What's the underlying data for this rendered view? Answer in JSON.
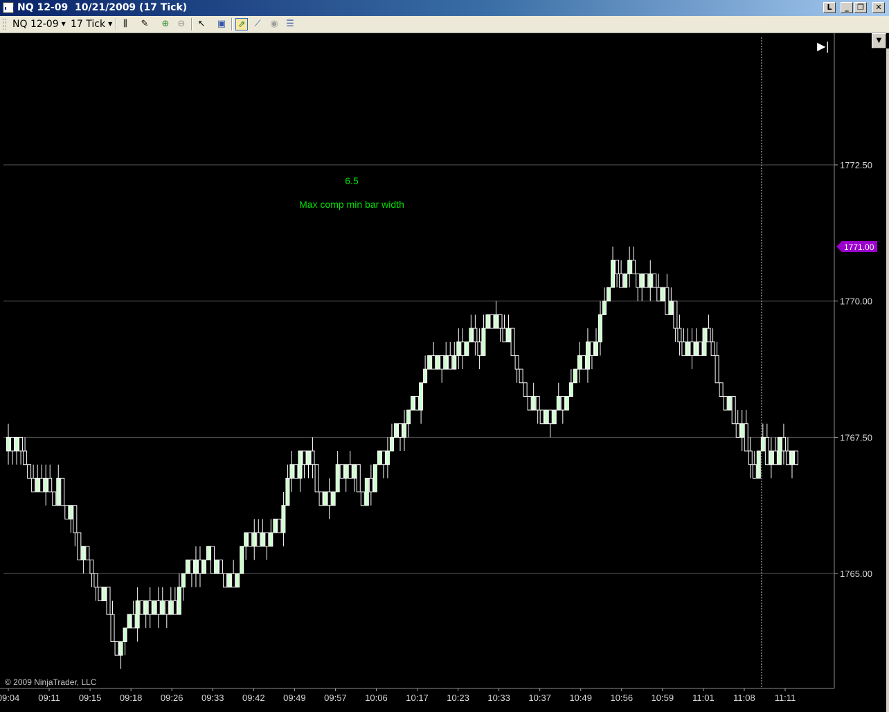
{
  "window": {
    "title": "NQ 12-09  10/21/2009 (17 Tick)",
    "buttons": {
      "link": "L",
      "minimize": "_",
      "restore": "❐",
      "close": "✕"
    }
  },
  "toolbar": {
    "instrument": "NQ 12-09",
    "interval": "17 Tick",
    "icons": [
      "bar-type-icon",
      "drawing-pencil-icon",
      "zoom-in-icon",
      "zoom-out-icon",
      "cursor-icon",
      "properties-icon",
      "data-box-icon",
      "indicators-icon",
      "strategies-icon",
      "chart-properties-icon"
    ]
  },
  "chart": {
    "annotation_value": "6.5",
    "annotation_label": "Max comp min bar width",
    "copyright": "© 2009 NinjaTrader, LLC",
    "last_price_label": "1771.00",
    "colors": {
      "background": "#000000",
      "up_bar": "#ccffcc",
      "down_bar": "#ffffff",
      "grid": "#5a5a5a",
      "last_price_marker": "#9900cc",
      "annotation": "#00e000"
    }
  },
  "chart_data": {
    "type": "candlestick",
    "instrument": "NQ 12-09",
    "date": "10/21/2009",
    "interval": "17 Tick",
    "y_ticks": [
      "1772.50",
      "1770.00",
      "1767.50",
      "1765.00"
    ],
    "y_tick_values": [
      1772.5,
      1770.0,
      1767.5,
      1765.0
    ],
    "ylim": [
      1763.75,
      1774.5
    ],
    "x_ticks": [
      "09:04",
      "09:11",
      "09:15",
      "09:18",
      "09:26",
      "09:33",
      "09:42",
      "09:49",
      "09:57",
      "10:06",
      "10:17",
      "10:23",
      "10:33",
      "10:37",
      "10:49",
      "10:56",
      "10:59",
      "11:01",
      "11:08",
      "11:11"
    ],
    "last_price": 1771.0,
    "bar_count": 190,
    "close_path": [
      {
        "bar": 0,
        "price": 1767.25
      },
      {
        "bar": 4,
        "price": 1767.0
      },
      {
        "bar": 8,
        "price": 1766.25
      },
      {
        "bar": 12,
        "price": 1766.75
      },
      {
        "bar": 16,
        "price": 1765.75
      },
      {
        "bar": 20,
        "price": 1765.0
      },
      {
        "bar": 24,
        "price": 1764.25
      },
      {
        "bar": 27,
        "price": 1763.75
      },
      {
        "bar": 31,
        "price": 1764.25
      },
      {
        "bar": 35,
        "price": 1764.5
      },
      {
        "bar": 39,
        "price": 1764.75
      },
      {
        "bar": 43,
        "price": 1765.0
      },
      {
        "bar": 48,
        "price": 1765.25
      },
      {
        "bar": 53,
        "price": 1764.5
      },
      {
        "bar": 58,
        "price": 1765.75
      },
      {
        "bar": 63,
        "price": 1765.75
      },
      {
        "bar": 68,
        "price": 1767.0
      },
      {
        "bar": 72,
        "price": 1767.25
      },
      {
        "bar": 76,
        "price": 1766.25
      },
      {
        "bar": 80,
        "price": 1767.0
      },
      {
        "bar": 85,
        "price": 1766.5
      },
      {
        "bar": 90,
        "price": 1767.25
      },
      {
        "bar": 95,
        "price": 1767.75
      },
      {
        "bar": 100,
        "price": 1769.0
      },
      {
        "bar": 104,
        "price": 1768.75
      },
      {
        "bar": 110,
        "price": 1769.25
      },
      {
        "bar": 115,
        "price": 1769.5
      },
      {
        "bar": 118,
        "price": 1769.75
      },
      {
        "bar": 122,
        "price": 1769.0
      },
      {
        "bar": 126,
        "price": 1768.0
      },
      {
        "bar": 130,
        "price": 1767.75
      },
      {
        "bar": 134,
        "price": 1768.5
      },
      {
        "bar": 138,
        "price": 1769.0
      },
      {
        "bar": 141,
        "price": 1769.5
      },
      {
        "bar": 145,
        "price": 1770.5
      },
      {
        "bar": 149,
        "price": 1770.25
      },
      {
        "bar": 153,
        "price": 1770.5
      },
      {
        "bar": 158,
        "price": 1769.75
      },
      {
        "bar": 163,
        "price": 1769.25
      },
      {
        "bar": 168,
        "price": 1769.25
      },
      {
        "bar": 172,
        "price": 1768.0
      },
      {
        "bar": 175,
        "price": 1767.5
      },
      {
        "bar": 178,
        "price": 1766.75
      },
      {
        "bar": 181,
        "price": 1767.25
      }
    ]
  }
}
